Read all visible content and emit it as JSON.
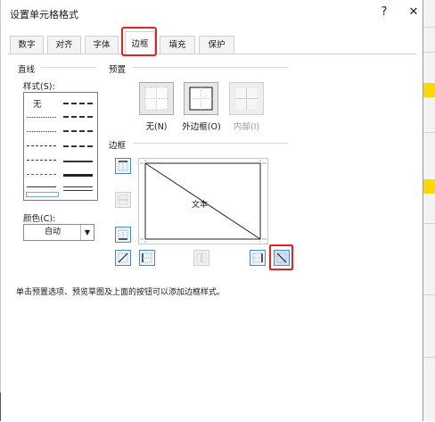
{
  "dialog": {
    "title": "设置单元格格式",
    "help_label": "?",
    "close_label": "✕"
  },
  "tabs": [
    {
      "label": "数字"
    },
    {
      "label": "对齐"
    },
    {
      "label": "字体"
    },
    {
      "label": "边框",
      "active": true
    },
    {
      "label": "填充"
    },
    {
      "label": "保护"
    }
  ],
  "line": {
    "section_label": "直线",
    "style_label": "样式(S):",
    "none_label": "无",
    "color_label": "颜色(C):",
    "color_value": "自动"
  },
  "presets": {
    "section_label": "预置",
    "items": [
      {
        "label": "无(N)",
        "enabled": true
      },
      {
        "label": "外边框(O)",
        "enabled": true
      },
      {
        "label": "内部(I)",
        "enabled": false
      }
    ]
  },
  "border": {
    "section_label": "边框",
    "preview_text": "文本"
  },
  "hint": "单击预置选项、预览草图及上面的按钮可以添加边框样式。",
  "colors": {
    "highlight": "#e02424",
    "accent": "#4a8acb",
    "sheet_fill": "#ffd800"
  }
}
